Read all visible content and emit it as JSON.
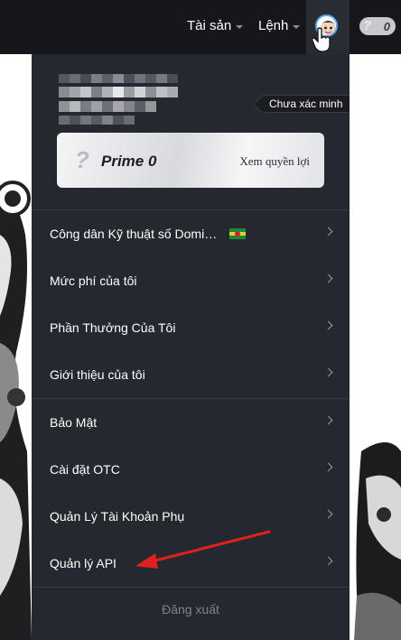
{
  "nav": {
    "assets_label": "Tài sản",
    "orders_label": "Lệnh",
    "prime_badge_level": "0"
  },
  "account": {
    "verify_status": "Chưa xác minh",
    "prime_level": "Prime 0",
    "prime_link": "Xem quyền lợi"
  },
  "menu": {
    "items": [
      {
        "label": "Công dân Kỹ thuật số Domi…"
      },
      {
        "label": "Mức phí của tôi"
      },
      {
        "label": "Phần Thưởng Của Tôi"
      },
      {
        "label": "Giới thiệu của tôi"
      },
      {
        "label": "Bảo Mật"
      },
      {
        "label": "Cài đặt OTC"
      },
      {
        "label": "Quản Lý Tài Khoản Phụ"
      },
      {
        "label": "Quản lý API"
      }
    ],
    "logout_label": "Đăng xuất"
  },
  "colors": {
    "topbar": "#16171c",
    "panel": "#26282f",
    "annotation_arrow": "#e0201c"
  }
}
